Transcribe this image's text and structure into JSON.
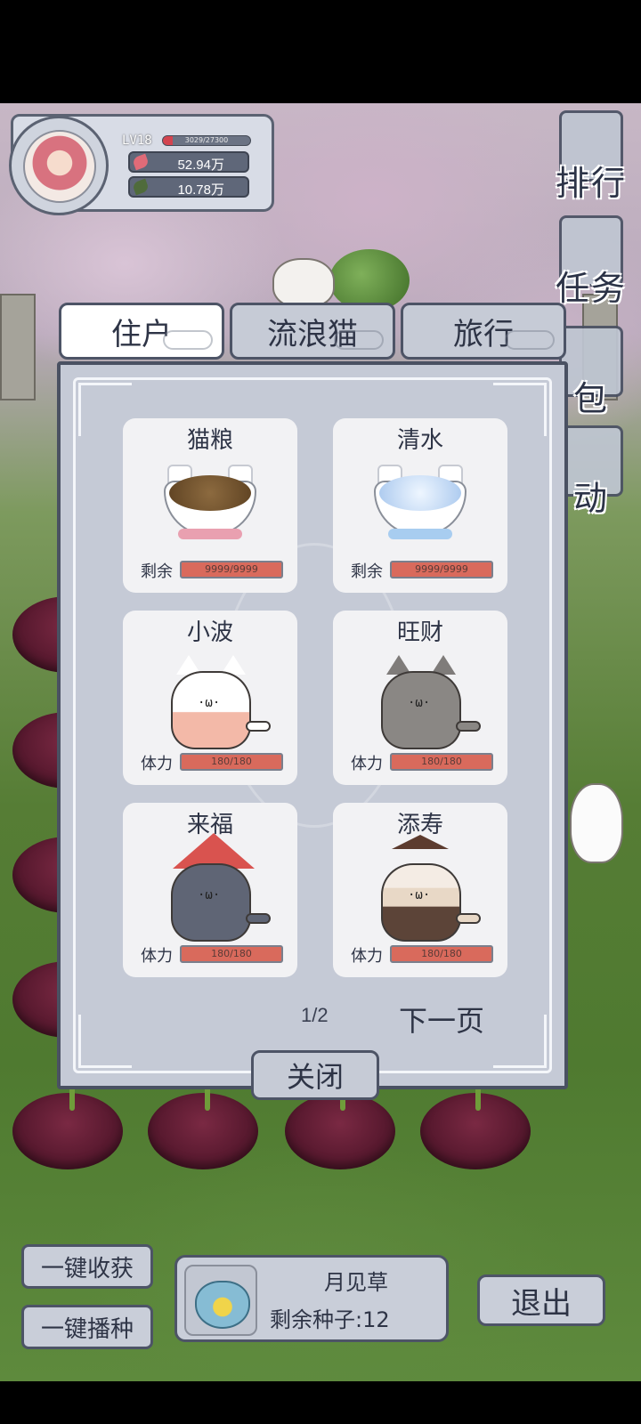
{
  "player": {
    "level": "LV18",
    "exp_text": "3029/27300",
    "exp_fraction": 0.11,
    "resource_1": "52.94万",
    "resource_2": "10.78万"
  },
  "side_menu": [
    {
      "label": "排行",
      "icon": "ranking-icon"
    },
    {
      "label": "任务",
      "icon": "task-icon"
    },
    {
      "label": "包",
      "icon": "bag-icon"
    },
    {
      "label": "动",
      "icon": "activity-icon"
    }
  ],
  "tabs": [
    {
      "label": "住户",
      "active": true
    },
    {
      "label": "流浪猫",
      "active": false
    },
    {
      "label": "旅行",
      "active": false
    }
  ],
  "cards": [
    {
      "name": "猫粮",
      "stat_label": "剩余",
      "stat_text": "9999/9999",
      "fraction": 1.0,
      "kind": "food-bowl"
    },
    {
      "name": "清水",
      "stat_label": "剩余",
      "stat_text": "9999/9999",
      "fraction": 1.0,
      "kind": "water-bowl"
    },
    {
      "name": "小波",
      "stat_label": "体力",
      "stat_text": "180/180",
      "fraction": 1.0,
      "kind": "cat-white"
    },
    {
      "name": "旺财",
      "stat_label": "体力",
      "stat_text": "180/180",
      "fraction": 1.0,
      "kind": "cat-gray"
    },
    {
      "name": "来福",
      "stat_label": "体力",
      "stat_text": "180/180",
      "fraction": 1.0,
      "kind": "cat-bonnet"
    },
    {
      "name": "添寿",
      "stat_label": "体力",
      "stat_text": "180/180",
      "fraction": 1.0,
      "kind": "cat-siamese"
    }
  ],
  "pager": {
    "text": "1/2",
    "next_label": "下一页"
  },
  "close_label": "关闭",
  "actions": {
    "harvest_all": "一键收获",
    "sow_all": "一键播种"
  },
  "seed": {
    "name": "月见草",
    "remaining": "剩余种子:12"
  },
  "exit_label": "退出",
  "colors": {
    "accent_red": "#d96a5c",
    "panel_bg": "#c5cad6",
    "frame": "#4d5466"
  }
}
